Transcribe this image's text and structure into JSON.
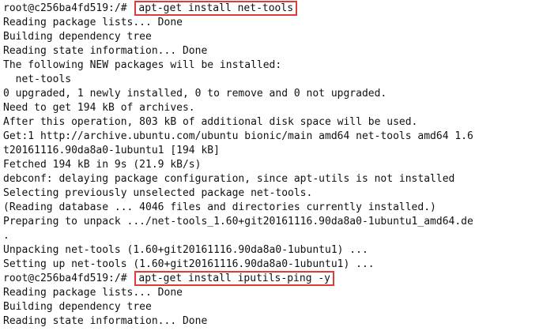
{
  "terminal": {
    "prompt": "root@c256ba4fd519:/#",
    "lines": [
      "Reading package lists... Done",
      "Building dependency tree",
      "Reading state information... Done",
      "The following NEW packages will be installed:",
      "  net-tools",
      "0 upgraded, 1 newly installed, 0 to remove and 0 not upgraded.",
      "Need to get 194 kB of archives.",
      "After this operation, 803 kB of additional disk space will be used.",
      "Get:1 http://archive.ubuntu.com/ubuntu bionic/main amd64 net-tools amd64 1.6",
      "t20161116.90da8a0-1ubuntu1 [194 kB]",
      "Fetched 194 kB in 9s (21.9 kB/s)",
      "debconf: delaying package configuration, since apt-utils is not installed",
      "Selecting previously unselected package net-tools.",
      "(Reading database ... 4046 files and directories currently installed.)",
      "Preparing to unpack .../net-tools_1.60+git20161116.90da8a0-1ubuntu1_amd64.de",
      ".",
      "Unpacking net-tools (1.60+git20161116.90da8a0-1ubuntu1) ...",
      "Setting up net-tools (1.60+git20161116.90da8a0-1ubuntu1) ..."
    ],
    "command1": "apt-get install net-tools",
    "command2": "apt-get install iputils-ping -y",
    "lines_after": [
      "Reading package lists... Done",
      "Building dependency tree",
      "Reading state information... Done"
    ],
    "highlight_color": "#e03b3b"
  }
}
